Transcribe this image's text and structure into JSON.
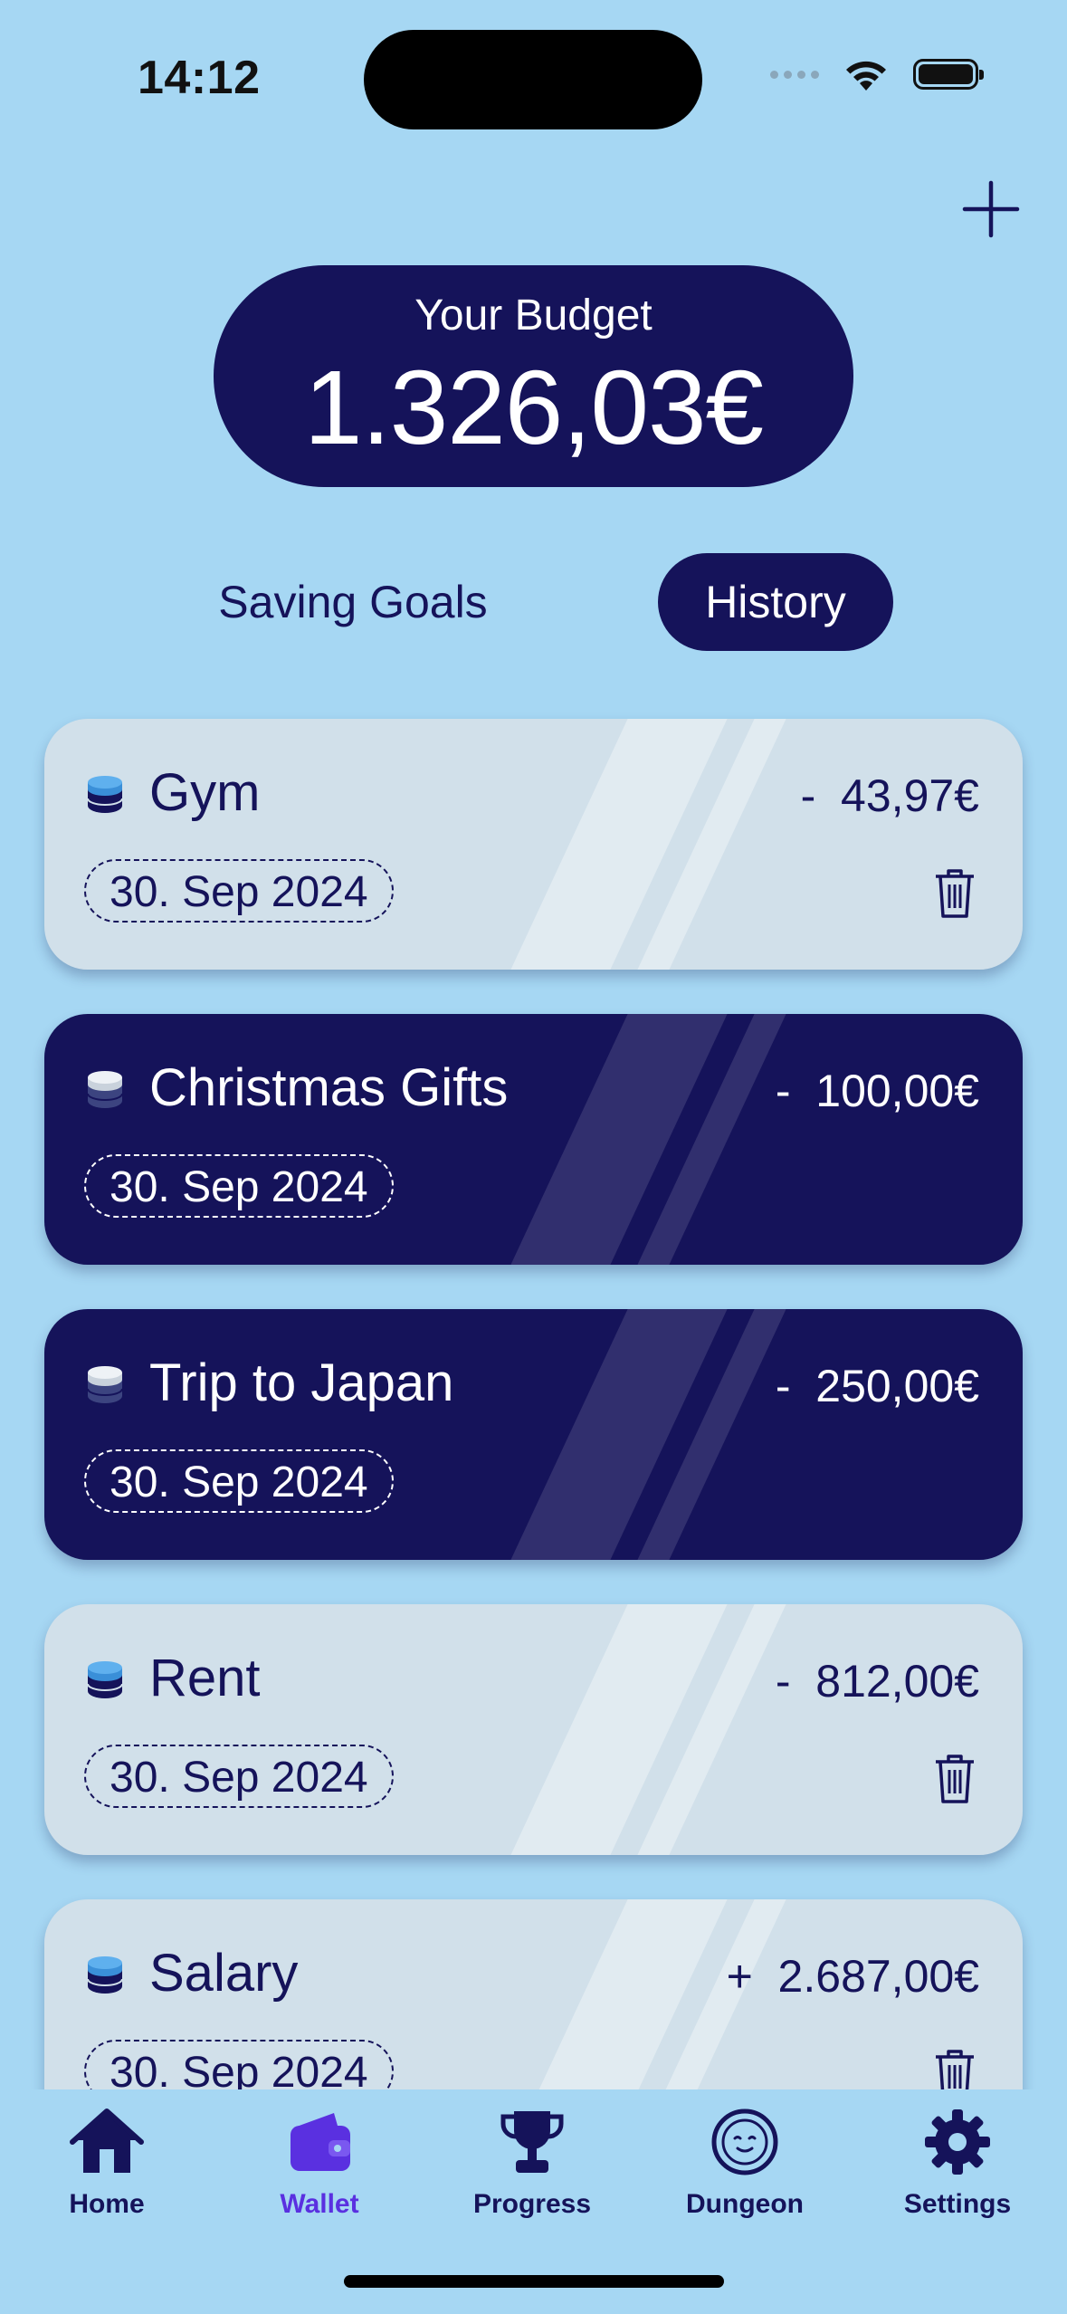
{
  "status": {
    "time": "14:12"
  },
  "budget": {
    "label": "Your Budget",
    "amount": "1.326,03€"
  },
  "tabs": [
    {
      "label": "Saving Goals",
      "selected": false
    },
    {
      "label": "History",
      "selected": true
    }
  ],
  "transactions": [
    {
      "title": "Gym",
      "amount": "-  43,97€",
      "date": "30. Sep 2024",
      "style": "light",
      "deletable": true
    },
    {
      "title": "Christmas Gifts",
      "amount": "-  100,00€",
      "date": "30. Sep 2024",
      "style": "dark",
      "deletable": false
    },
    {
      "title": "Trip to Japan",
      "amount": "-  250,00€",
      "date": "30. Sep 2024",
      "style": "dark",
      "deletable": false
    },
    {
      "title": "Rent",
      "amount": "-  812,00€",
      "date": "30. Sep 2024",
      "style": "light",
      "deletable": true
    },
    {
      "title": "Salary",
      "amount": "+  2.687,00€",
      "date": "30. Sep 2024",
      "style": "light",
      "deletable": true
    }
  ],
  "nav": [
    {
      "label": "Home",
      "icon": "house-icon",
      "active": false
    },
    {
      "label": "Wallet",
      "icon": "wallet-icon",
      "active": true
    },
    {
      "label": "Progress",
      "icon": "trophy-icon",
      "active": false
    },
    {
      "label": "Dungeon",
      "icon": "face-icon",
      "active": false
    },
    {
      "label": "Settings",
      "icon": "gear-icon",
      "active": false
    }
  ],
  "colors": {
    "background": "#a6d7f3",
    "navy": "#15135a",
    "light_card": "#d1e0ea",
    "active_nav": "#5a30e0",
    "coin_blue": "#3a8fd8"
  }
}
